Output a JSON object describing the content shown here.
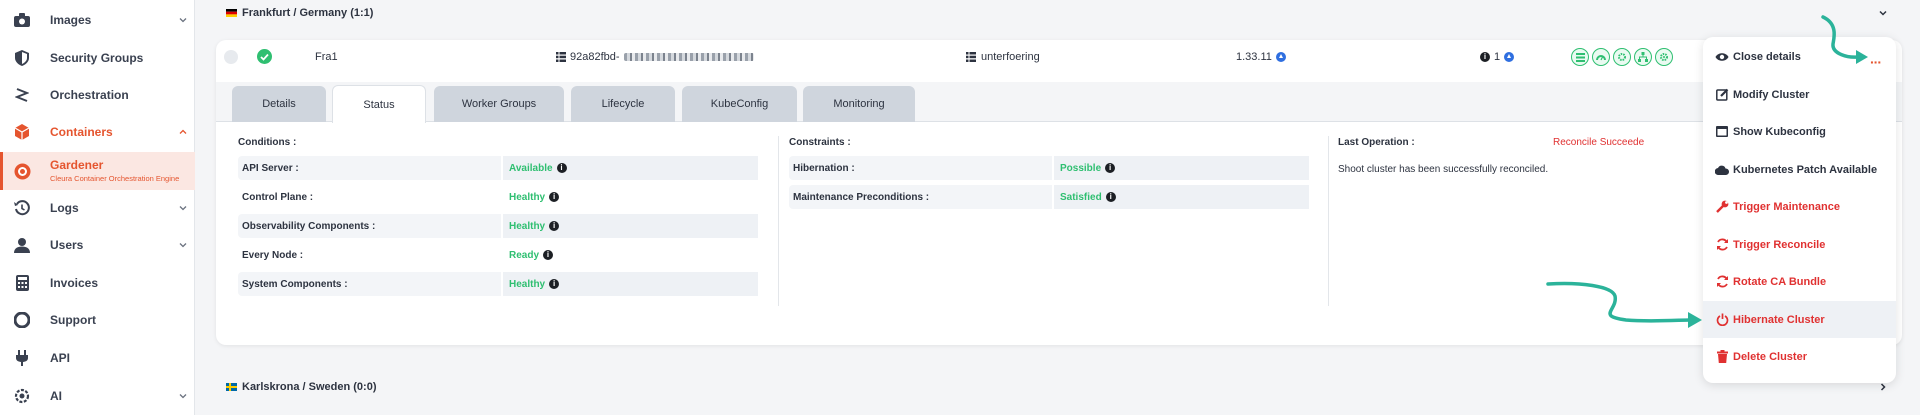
{
  "sidebar": {
    "items": [
      {
        "label": "Images",
        "icon": "camera-icon"
      },
      {
        "label": "Security Groups",
        "icon": "shield-icon"
      },
      {
        "label": "Orchestration",
        "icon": "orchestration-icon"
      },
      {
        "label": "Containers",
        "icon": "cube-icon"
      },
      {
        "label": "Gardener",
        "sub": "Cleura Container Orchestration Engine",
        "icon": "gardener-icon"
      },
      {
        "label": "Logs",
        "icon": "history-icon"
      },
      {
        "label": "Users",
        "icon": "user-icon"
      },
      {
        "label": "Invoices",
        "icon": "calculator-icon"
      },
      {
        "label": "Support",
        "icon": "lifebuoy-icon"
      },
      {
        "label": "API",
        "icon": "plug-icon"
      },
      {
        "label": "AI",
        "icon": "ai-icon"
      }
    ]
  },
  "regions": {
    "frankfurt": "Frankfurt / Germany (1:1)",
    "karlskrona": "Karlskrona / Sweden (0:0)"
  },
  "cluster": {
    "name": "Fra1",
    "id_prefix": "92a82fbd-",
    "project": "unterfoering",
    "version": "1.33.11",
    "info_count": "1"
  },
  "tabs": [
    "Details",
    "Status",
    "Worker Groups",
    "Lifecycle",
    "KubeConfig",
    "Monitoring"
  ],
  "conditions": {
    "title": "Conditions :",
    "rows": [
      {
        "key": "API Server :",
        "value": "Available"
      },
      {
        "key": "Control Plane :",
        "value": "Healthy"
      },
      {
        "key": "Observability Components :",
        "value": "Healthy"
      },
      {
        "key": "Every Node :",
        "value": "Ready"
      },
      {
        "key": "System Components :",
        "value": "Healthy"
      }
    ]
  },
  "constraints": {
    "title": "Constraints :",
    "rows": [
      {
        "key": "Hibernation :",
        "value": "Possible"
      },
      {
        "key": "Maintenance Preconditions :",
        "value": "Satisfied"
      }
    ]
  },
  "last_operation": {
    "label": "Last Operation :",
    "value": "Reconcile Succeede",
    "message": "Shoot cluster has been successfully reconciled."
  },
  "menu": {
    "items": [
      {
        "label": "Close details",
        "icon": "eye-icon"
      },
      {
        "label": "Modify Cluster",
        "icon": "edit-icon"
      },
      {
        "label": "Show Kubeconfig",
        "icon": "window-icon"
      },
      {
        "label": "Kubernetes Patch Available",
        "icon": "cloud-icon"
      },
      {
        "label": "Trigger Maintenance",
        "icon": "wrench-icon"
      },
      {
        "label": "Trigger Reconcile",
        "icon": "sync-icon"
      },
      {
        "label": "Rotate CA Bundle",
        "icon": "rotate-icon"
      },
      {
        "label": "Hibernate Cluster",
        "icon": "power-icon"
      },
      {
        "label": "Delete Cluster",
        "icon": "trash-icon"
      }
    ],
    "more": "···"
  },
  "colors": {
    "accent": "#e5552f",
    "success": "#2fbf71",
    "danger": "#e03131",
    "annotation": "#2bb39a"
  }
}
